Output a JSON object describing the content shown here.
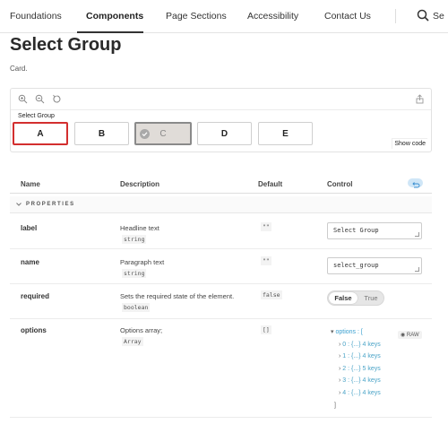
{
  "nav": {
    "items": [
      "Foundations",
      "Components",
      "Page Sections",
      "Accessibility",
      "Contact Us"
    ],
    "active_index": 1,
    "search_label": "Se"
  },
  "page": {
    "title": "Select Group",
    "subtitle": "Card."
  },
  "preview": {
    "group_label": "Select Group",
    "options": [
      "A",
      "B",
      "C",
      "D",
      "E"
    ],
    "selected": "A",
    "disabled": "C",
    "show_code_label": "Show code"
  },
  "table": {
    "headers": {
      "name": "Name",
      "description": "Description",
      "default": "Default",
      "control": "Control"
    },
    "group_label": "PROPERTIES",
    "rows": {
      "label": {
        "name": "label",
        "desc": "Headline text",
        "type": "string",
        "default": "\"\"",
        "control_value": "Select Group"
      },
      "name": {
        "name": "name",
        "desc": "Paragraph text",
        "type": "string",
        "default": "\"\"",
        "control_value": "select_group"
      },
      "required": {
        "name": "required",
        "desc": "Sets the required state of the element.",
        "type": "boolean",
        "default": "false",
        "toggle_false": "False",
        "toggle_true": "True"
      },
      "options": {
        "name": "options",
        "desc": "Options array;",
        "type": "Array",
        "default": "[]",
        "tree_head": "options : [",
        "tree_items": [
          "0 : {...} 4 keys",
          "1 : {...} 4 keys",
          "2 : {...} 5 keys",
          "3 : {...} 4 keys",
          "4 : {...} 4 keys"
        ],
        "tree_close": "]",
        "raw_label": "RAW"
      }
    }
  },
  "colors": {
    "accent_red": "#d32f2f",
    "tree_blue": "#3aa0d0"
  }
}
